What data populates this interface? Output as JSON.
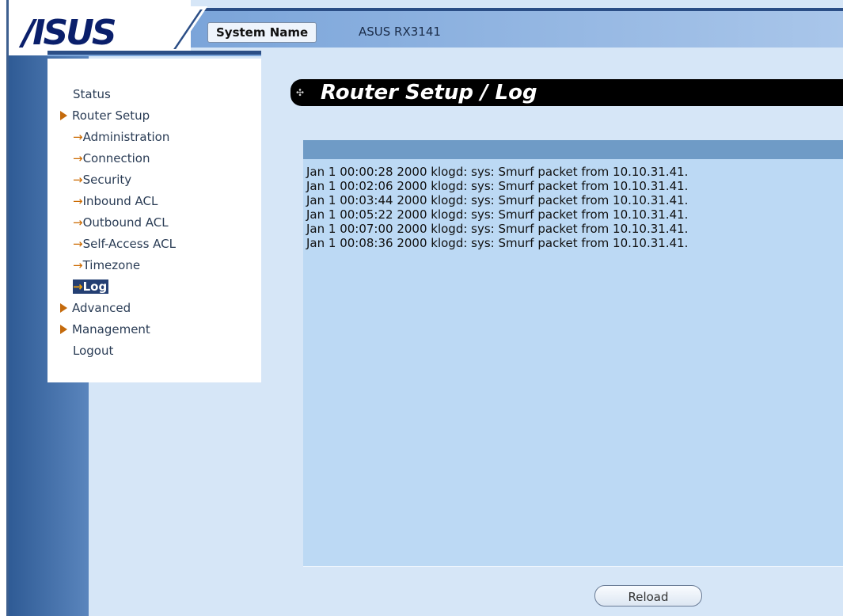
{
  "header": {
    "logo_text": "/ISUS",
    "system_name_label": "System Name",
    "system_name_value": "ASUS RX3141"
  },
  "menu": {
    "items": [
      {
        "label": "Status",
        "type": "top",
        "bullet": false
      },
      {
        "label": "Router Setup",
        "type": "top",
        "bullet": true
      },
      {
        "label": "Administration",
        "type": "sub"
      },
      {
        "label": "Connection",
        "type": "sub"
      },
      {
        "label": "Security",
        "type": "sub"
      },
      {
        "label": "Inbound ACL",
        "type": "sub"
      },
      {
        "label": "Outbound ACL",
        "type": "sub"
      },
      {
        "label": "Self-Access ACL",
        "type": "sub"
      },
      {
        "label": "Timezone",
        "type": "sub"
      },
      {
        "label": "Log",
        "type": "sub",
        "current": true
      },
      {
        "label": "Advanced",
        "type": "top",
        "bullet": true
      },
      {
        "label": "Management",
        "type": "top",
        "bullet": true
      },
      {
        "label": "Logout",
        "type": "top",
        "bullet": false
      }
    ],
    "sub_arrow": "→"
  },
  "page": {
    "title": "Router Setup / Log"
  },
  "log": {
    "lines": [
      "Jan 1 00:00:28 2000 klogd: sys: Smurf packet from 10.10.31.41.",
      "Jan 1 00:02:06 2000 klogd: sys: Smurf packet from 10.10.31.41.",
      "Jan 1 00:03:44 2000 klogd: sys: Smurf packet from 10.10.31.41.",
      "Jan 1 00:05:22 2000 klogd: sys: Smurf packet from 10.10.31.41.",
      "Jan 1 00:07:00 2000 klogd: sys: Smurf packet from 10.10.31.41.",
      "Jan 1 00:08:36 2000 klogd: sys: Smurf packet from 10.10.31.41."
    ]
  },
  "actions": {
    "reload_label": "Reload"
  },
  "colors": {
    "sidebar_blue": "#2f5b95",
    "content_bg": "#d6e6f7",
    "log_bg": "#bcd9f4",
    "log_header": "#6f9bc6",
    "menu_current_bg": "#243f73",
    "accent_orange": "#c46a0c"
  }
}
